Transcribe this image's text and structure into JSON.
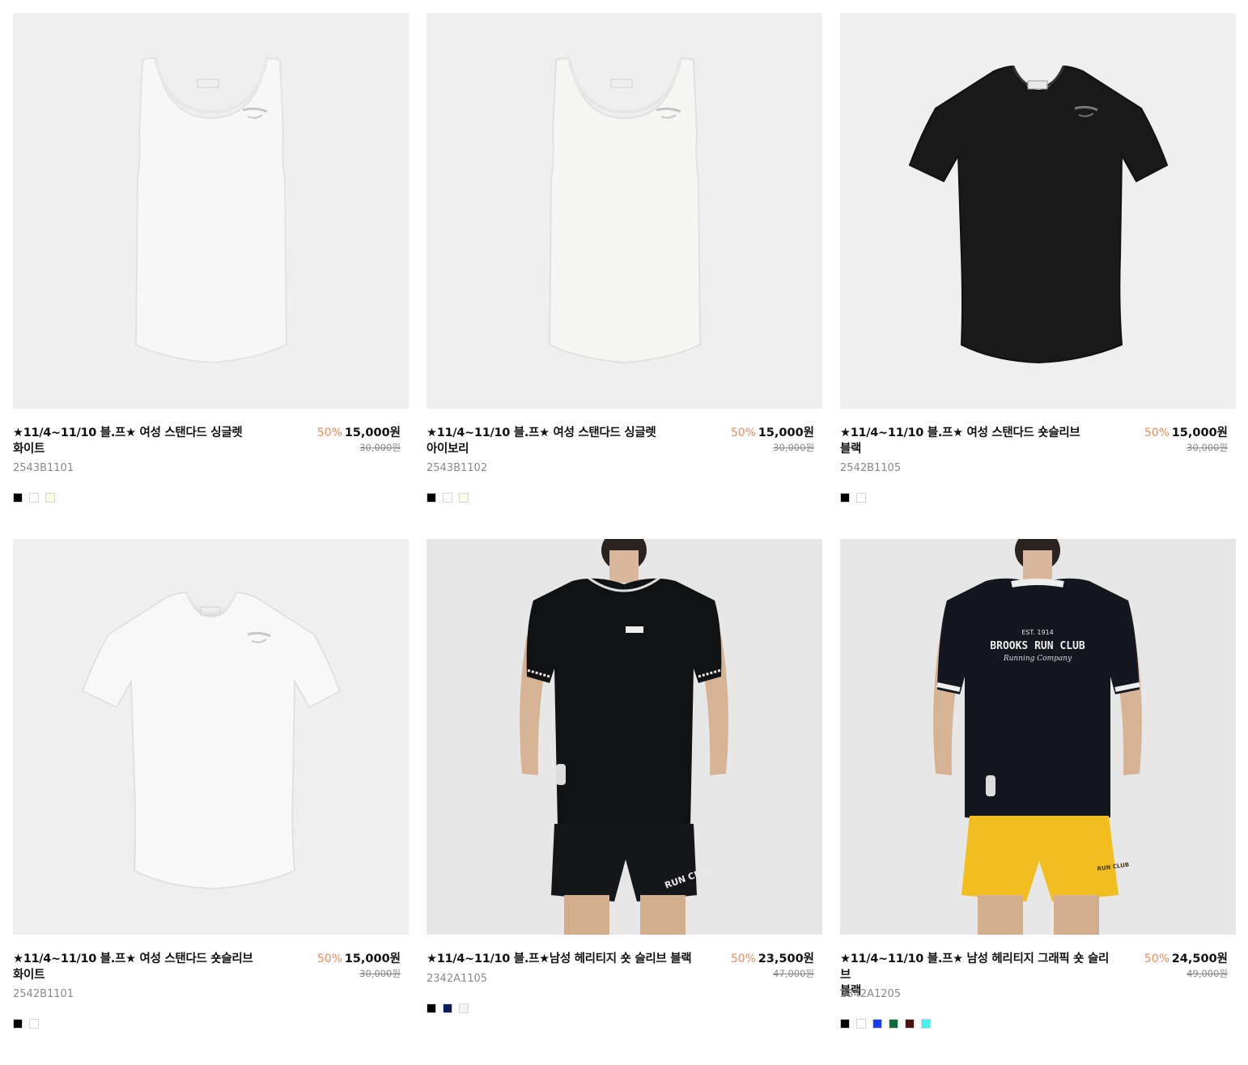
{
  "products": [
    {
      "title_line1": "★11/4~11/10 블.프★ 여성 스탠다드 싱글렛",
      "title_line2": "화이트",
      "discount": "50%",
      "price": "15,000원",
      "original_price": "30,000원",
      "code": "2543B1101",
      "colors": [
        "#000000",
        "#ffffff",
        "#fbfbe6"
      ],
      "image": "white-singlet"
    },
    {
      "title_line1": "★11/4~11/10 블.프★ 여성 스탠다드 싱글렛",
      "title_line2": "아이보리",
      "discount": "50%",
      "price": "15,000원",
      "original_price": "30,000원",
      "code": "2543B1102",
      "colors": [
        "#000000",
        "#ffffff",
        "#fbfbe6"
      ],
      "image": "ivory-singlet"
    },
    {
      "title_line1": "★11/4~11/10 블.프★ 여성 스탠다드 숏슬리브",
      "title_line2": "블랙",
      "discount": "50%",
      "price": "15,000원",
      "original_price": "30,000원",
      "code": "2542B1105",
      "colors": [
        "#000000",
        "#ffffff"
      ],
      "image": "black-tshirt"
    },
    {
      "title_line1": "★11/4~11/10 블.프★ 여성 스탠다드 숏슬리브",
      "title_line2": "화이트",
      "discount": "50%",
      "price": "15,000원",
      "original_price": "30,000원",
      "code": "2542B1101",
      "colors": [
        "#000000",
        "#ffffff"
      ],
      "image": "white-tshirt"
    },
    {
      "title_line1": "★11/4~11/10 블.프★남성 헤리티지 숏 슬리브 블랙",
      "title_line2": "",
      "discount": "50%",
      "price": "23,500원",
      "original_price": "47,000원",
      "code": "2342A1105",
      "colors": [
        "#000000",
        "#0d1b5c",
        "#f3f3f3"
      ],
      "image": "male-model-black-shorts"
    },
    {
      "title_line1": "★11/4~11/10 블.프★ 남성 헤리티지 그래픽 숏 슬리브",
      "title_line2": "블랙",
      "discount": "50%",
      "price": "24,500원",
      "original_price": "49,000원",
      "code": "2342A1205",
      "colors": [
        "#000000",
        "#ffffff",
        "#1a3cf0",
        "#0d6b3d",
        "#4a120c",
        "#3ff2f0"
      ],
      "image": "male-model-graphic-yellow-shorts",
      "graphic_text": {
        "line1": "EST. 1914",
        "line2": "BROOKS RUN CLUB",
        "line3": "Running Company"
      },
      "shorts_text": "RUN CLUB"
    }
  ]
}
